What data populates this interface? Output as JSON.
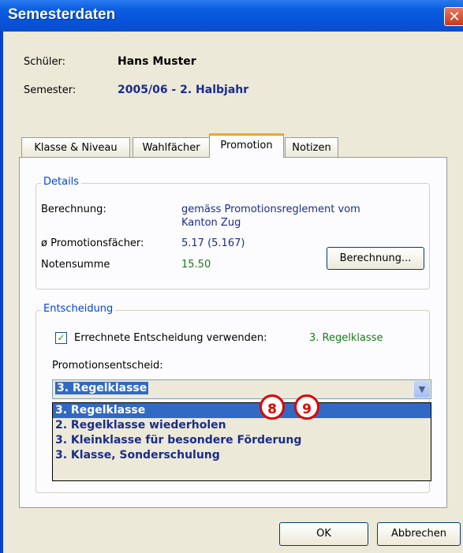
{
  "window": {
    "title": "Semesterdaten",
    "close_symbol": "✕"
  },
  "header": {
    "student_label": "Schüler:",
    "student_value": "Hans Muster",
    "semester_label": "Semester:",
    "semester_value": "2005/06 - 2. Halbjahr"
  },
  "tabs": [
    {
      "label": "Klasse & Niveau"
    },
    {
      "label": "Wahlfächer"
    },
    {
      "label": "Promotion",
      "active": true
    },
    {
      "label": "Notizen"
    }
  ],
  "details": {
    "legend": "Details",
    "calc_label": "Berechnung:",
    "calc_value_line1": "gemäss Promotionsreglement vom",
    "calc_value_line2": "Kanton Zug",
    "avg_label": "ø Promotionsfächer:",
    "avg_value": "5.17  (5.167)",
    "sum_label": "Notensumme",
    "sum_value": "15.50",
    "calc_button": "Berechnung..."
  },
  "decision": {
    "legend": "Entscheidung",
    "checkbox_label": "Errechnete Entscheidung verwenden:",
    "checkbox_checked": true,
    "computed_value": "3. Regelklasse",
    "field_label": "Promotionsentscheid:",
    "selected": "3. Regelklasse",
    "options": [
      "3. Regelklasse",
      "2. Regelklasse wiederholen",
      "3. Kleinklasse für besondere Förderung",
      "3. Klasse, Sonderschulung"
    ]
  },
  "markers": [
    "8",
    "9"
  ],
  "buttons": {
    "ok": "OK",
    "cancel": "Abbrechen"
  }
}
